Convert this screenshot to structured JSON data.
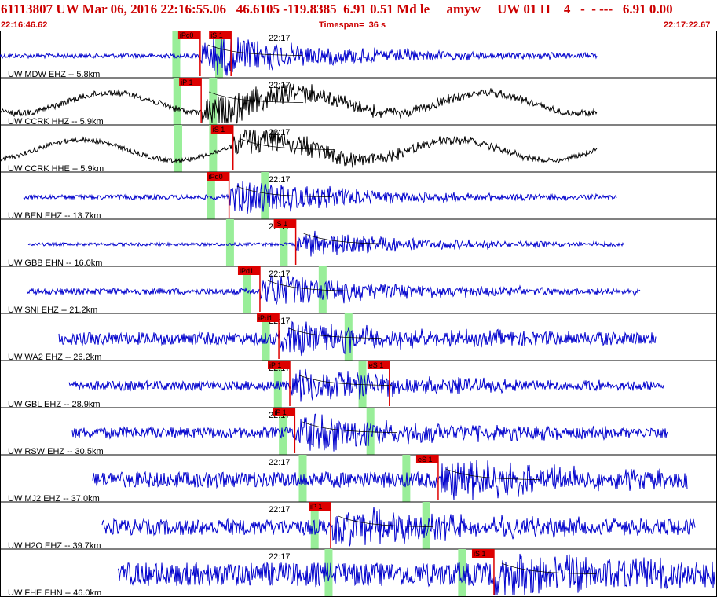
{
  "header": {
    "title": "61113807 UW Mar 06, 2016 22:16:55.06   46.6105 -119.8385  6.91 0.51 Md le     amyw     UW 01 H    4   -  - ---   6.91 0.00",
    "start_time": "22:16:46.62",
    "timespan": "Timespan=  36 s",
    "end_time": "22:17:22.67"
  },
  "chart_data": {
    "type": "line",
    "time_window": [
      "22:16:46.62",
      "22:17:22.67"
    ],
    "timespan_s": 36,
    "minute_label": "22:17",
    "colors": {
      "trace_blue": "#0000cc",
      "trace_black": "#000000",
      "pick": "#dd0000",
      "window": "#99ee99",
      "grid": "#000000"
    },
    "series": [
      {
        "name": "UW MDW EHZ -- 5.8km",
        "color": "#0000cc",
        "picks": [
          {
            "label": "iPc0",
            "t": 10.05
          },
          {
            "label": "iS 1",
            "t": 11.6
          }
        ],
        "windows": [
          8.85,
          11.0
        ]
      },
      {
        "name": "UW CCRK HHZ -- 5.9km",
        "color": "#000000",
        "picks": [
          {
            "label": "iP 1",
            "t": 10.1
          }
        ],
        "windows": [
          8.9,
          10.7
        ]
      },
      {
        "name": "UW CCRK HHE -- 5.9km",
        "color": "#000000",
        "picks": [
          {
            "label": "iS 1",
            "t": 11.7
          }
        ],
        "windows": [
          8.95,
          10.7
        ]
      },
      {
        "name": "UW BEN EHZ -- 13.7km",
        "color": "#0000cc",
        "picks": [
          {
            "label": "iPd0",
            "t": 11.5
          }
        ],
        "windows": [
          10.6,
          13.3
        ]
      },
      {
        "name": "UW GBB EHN -- 16.0km",
        "color": "#0000cc",
        "picks": [
          {
            "label": "iS 1",
            "t": 14.85
          }
        ],
        "windows": [
          11.55,
          14.25
        ]
      },
      {
        "name": "UW SNI EHZ -- 21.2km",
        "color": "#0000cc",
        "picks": [
          {
            "label": "iPd1",
            "t": 13.05
          }
        ],
        "windows": [
          12.4,
          16.2
        ]
      },
      {
        "name": "UW WA2 EHZ -- 26.2km",
        "color": "#0000cc",
        "picks": [
          {
            "label": "iPd1",
            "t": 14.0
          }
        ],
        "windows": [
          13.35,
          17.5
        ]
      },
      {
        "name": "UW GBL EHZ -- 28.9km",
        "color": "#0000cc",
        "picks": [
          {
            "label": "iP 1",
            "t": 14.55
          },
          {
            "label": "eS 1",
            "t": 19.55
          }
        ],
        "windows": [
          13.95,
          18.2
        ]
      },
      {
        "name": "UW RSW EHZ -- 30.5km",
        "color": "#0000cc",
        "picks": [
          {
            "label": "iP 1",
            "t": 14.8
          }
        ],
        "windows": [
          14.2,
          18.6
        ]
      },
      {
        "name": "UW MJ2 EHZ -- 37.0km",
        "color": "#0000cc",
        "picks": [
          {
            "label": "eS 1",
            "t": 22.0
          }
        ],
        "windows": [
          15.2,
          20.4
        ]
      },
      {
        "name": "UW H2O EHZ -- 39.7km",
        "color": "#0000cc",
        "picks": [
          {
            "label": "iP 1",
            "t": 16.6
          }
        ],
        "windows": [
          15.8,
          21.4
        ]
      },
      {
        "name": "UW FHE EHN -- 46.0km",
        "color": "#0000cc",
        "picks": [
          {
            "label": "iS 1",
            "t": 24.8
          }
        ],
        "windows": [
          16.5,
          23.2
        ]
      }
    ]
  }
}
